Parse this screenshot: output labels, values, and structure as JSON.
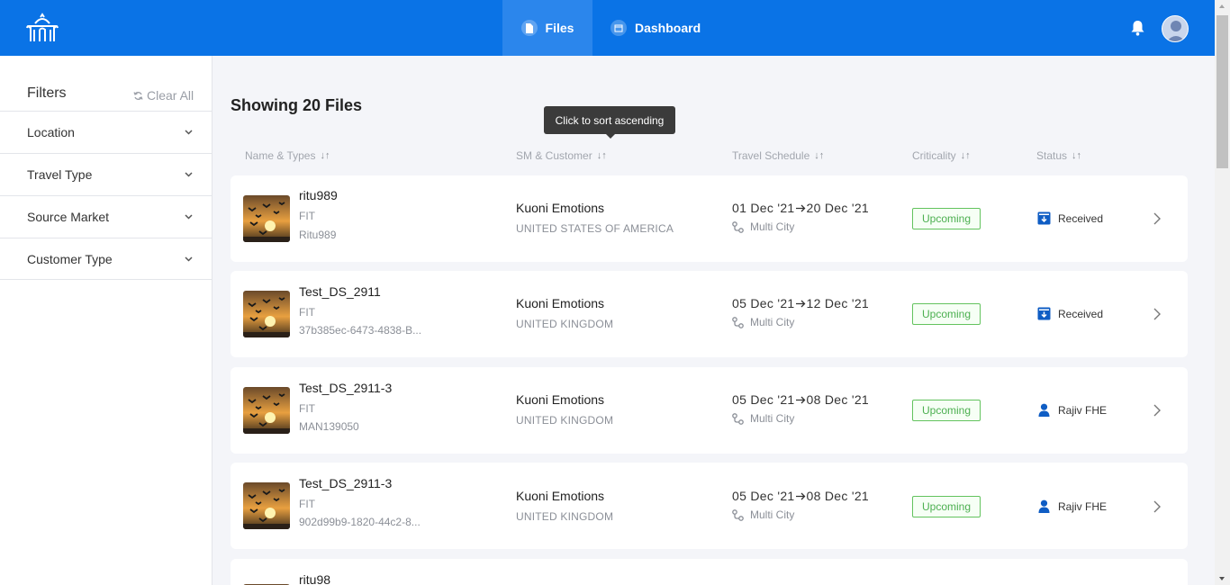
{
  "nav": {
    "tabs": [
      {
        "label": "Files",
        "icon": "file-icon",
        "active": true
      },
      {
        "label": "Dashboard",
        "icon": "calendar-icon",
        "active": false
      }
    ]
  },
  "sidebar": {
    "title": "Filters",
    "clear_all": "Clear All",
    "filters": [
      "Location",
      "Travel Type",
      "Source Market",
      "Customer Type"
    ]
  },
  "main": {
    "heading": "Showing 20 Files",
    "tooltip": "Click to sort ascending",
    "columns": [
      "Name & Types",
      "SM & Customer",
      "Travel Schedule",
      "Criticality",
      "Status"
    ],
    "rows": [
      {
        "name": "ritu989",
        "type": "FIT",
        "id": "Ritu989",
        "customer": "Kuoni Emotions",
        "country": "UNITED STATES OF AMERICA",
        "from": "01 Dec '21",
        "to": "20 Dec '21",
        "route": "Multi City",
        "criticality": "Upcoming",
        "status": "Received",
        "status_icon": "inbox-icon"
      },
      {
        "name": "Test_DS_2911",
        "type": "FIT",
        "id": "37b385ec-6473-4838-B...",
        "customer": "Kuoni Emotions",
        "country": "UNITED KINGDOM",
        "from": "05 Dec '21",
        "to": "12 Dec '21",
        "route": "Multi City",
        "criticality": "Upcoming",
        "status": "Received",
        "status_icon": "inbox-icon"
      },
      {
        "name": "Test_DS_2911-3",
        "type": "FIT",
        "id": "MAN139050",
        "customer": "Kuoni Emotions",
        "country": "UNITED KINGDOM",
        "from": "05 Dec '21",
        "to": "08 Dec '21",
        "route": "Multi City",
        "criticality": "Upcoming",
        "status": "Rajiv FHE",
        "status_icon": "user-icon"
      },
      {
        "name": "Test_DS_2911-3",
        "type": "FIT",
        "id": "902d99b9-1820-44c2-8...",
        "customer": "Kuoni Emotions",
        "country": "UNITED KINGDOM",
        "from": "05 Dec '21",
        "to": "08 Dec '21",
        "route": "Multi City",
        "criticality": "Upcoming",
        "status": "Rajiv FHE",
        "status_icon": "user-icon"
      },
      {
        "name": "ritu98",
        "type": "",
        "id": "",
        "customer": "",
        "country": "",
        "from": "",
        "to": "",
        "route": "",
        "criticality": "",
        "status": "",
        "status_icon": ""
      }
    ]
  },
  "colors": {
    "brand_blue": "#0a73e6",
    "status_blue": "#0f5dc4",
    "upcoming_green": "#4caf50"
  }
}
